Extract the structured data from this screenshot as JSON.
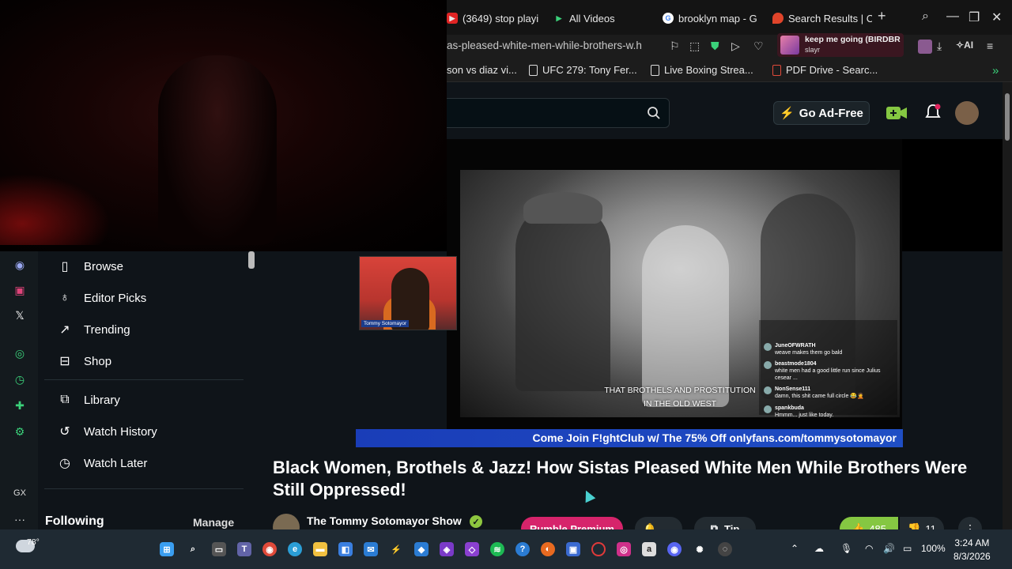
{
  "browser": {
    "tabs": [
      {
        "label": "(3649) stop playi",
        "icon": "youtube-icon",
        "color": "#e02424"
      },
      {
        "label": "All Videos",
        "icon": "play-icon",
        "color": "#3bd17a"
      },
      {
        "label": "brooklyn map - G",
        "icon": "google-icon",
        "color": "#4285f4"
      },
      {
        "label": "Search Results | C",
        "icon": "pin-icon",
        "color": "#e0442a"
      }
    ],
    "new_tab": "+",
    "url": "as-pleased-white-men-while-brothers-w.h",
    "music": {
      "title": "keep me going (BIRDBR",
      "artist": "slayr"
    },
    "ai_label": "AI",
    "bookmarks": [
      {
        "label": "son vs diaz vi..."
      },
      {
        "label": "UFC 279: Tony Fer..."
      },
      {
        "label": "Live Boxing Strea..."
      },
      {
        "label": "PDF Drive - Searc..."
      }
    ]
  },
  "header": {
    "search_placeholder": "",
    "go_ad_free": "Go Ad-Free"
  },
  "sidebar": {
    "items": [
      {
        "label": "Browse",
        "icon": "browse-icon"
      },
      {
        "label": "Editor Picks",
        "icon": "award-icon"
      },
      {
        "label": "Trending",
        "icon": "trending-icon"
      },
      {
        "label": "Shop",
        "icon": "shop-icon"
      },
      {
        "label": "Library",
        "icon": "library-icon"
      },
      {
        "label": "Watch History",
        "icon": "history-icon"
      },
      {
        "label": "Watch Later",
        "icon": "clock-icon"
      }
    ],
    "following": "Following",
    "manage": "Manage"
  },
  "rail": {
    "gx": "GX",
    "more": "···"
  },
  "video": {
    "pip_label": "Tommy Sotomayor",
    "subtitle_line1": "THAT BROTHELS AND PROSTITUTION",
    "subtitle_line2": "IN THE OLD WEST",
    "chat": [
      {
        "user": "JuneOFWRATH",
        "text": "weave makes them go bald"
      },
      {
        "user": "beastmode1804",
        "text": "white men had a good little run since Julius cesear ..."
      },
      {
        "user": "NonSense111",
        "text": "damn, this shit came full circle 😂🤦"
      },
      {
        "user": "spankbuda",
        "text": "Hmmm... just like today."
      }
    ],
    "banner": "Come Join F!ghtClub w/ The 75% Off onlyfans.com/tommysotomayor",
    "title": "Black Women, Brothels & Jazz! How Sistas Pleased White Men While Brothers Were Still Oppressed!",
    "channel": "The Tommy Sotomayor Show",
    "premium": "Rumble Premium",
    "tip": "Tip",
    "likes": "485",
    "dislikes": "11"
  },
  "taskbar": {
    "temp": "78°",
    "battery": "100%",
    "time": "3:24 AM",
    "date": "8/3/2026"
  }
}
